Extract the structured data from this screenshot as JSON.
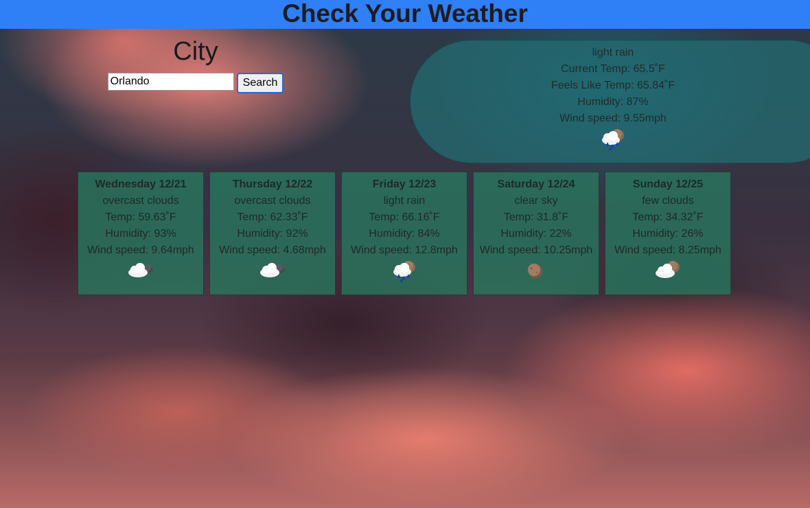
{
  "header": {
    "title": "Check Your Weather"
  },
  "search": {
    "label": "City",
    "value": "Orlando",
    "button_label": "Search"
  },
  "current": {
    "description": "light rain",
    "temp": "Current Temp: 65.5˚F",
    "feels_like": "Feels Like Temp: 65.84˚F",
    "humidity": "Humidity: 87%",
    "wind": "Wind speed: 9.55mph",
    "icon": "rain-cloud-icon"
  },
  "forecast": [
    {
      "day": "Wednesday 12/21",
      "description": "overcast clouds",
      "temp": "Temp: 59.63˚F",
      "humidity": "Humidity: 93%",
      "wind": "Wind speed: 9.64mph",
      "icon": "cloud-moon-icon"
    },
    {
      "day": "Thursday 12/22",
      "description": "overcast clouds",
      "temp": "Temp: 62.33˚F",
      "humidity": "Humidity: 92%",
      "wind": "Wind speed: 4.68mph",
      "icon": "cloud-moon-icon"
    },
    {
      "day": "Friday 12/23",
      "description": "light rain",
      "temp": "Temp: 66.16˚F",
      "humidity": "Humidity: 84%",
      "wind": "Wind speed: 12.8mph",
      "icon": "rain-cloud-icon"
    },
    {
      "day": "Saturday 12/24",
      "description": "clear sky",
      "temp": "Temp: 31.8˚F",
      "humidity": "Humidity: 22%",
      "wind": "Wind speed: 10.25mph",
      "icon": "moon-icon"
    },
    {
      "day": "Sunday 12/25",
      "description": "few clouds",
      "temp": "Temp: 34.32˚F",
      "humidity": "Humidity: 26%",
      "wind": "Wind speed: 8.25mph",
      "icon": "cloud-moon-icon"
    }
  ]
}
